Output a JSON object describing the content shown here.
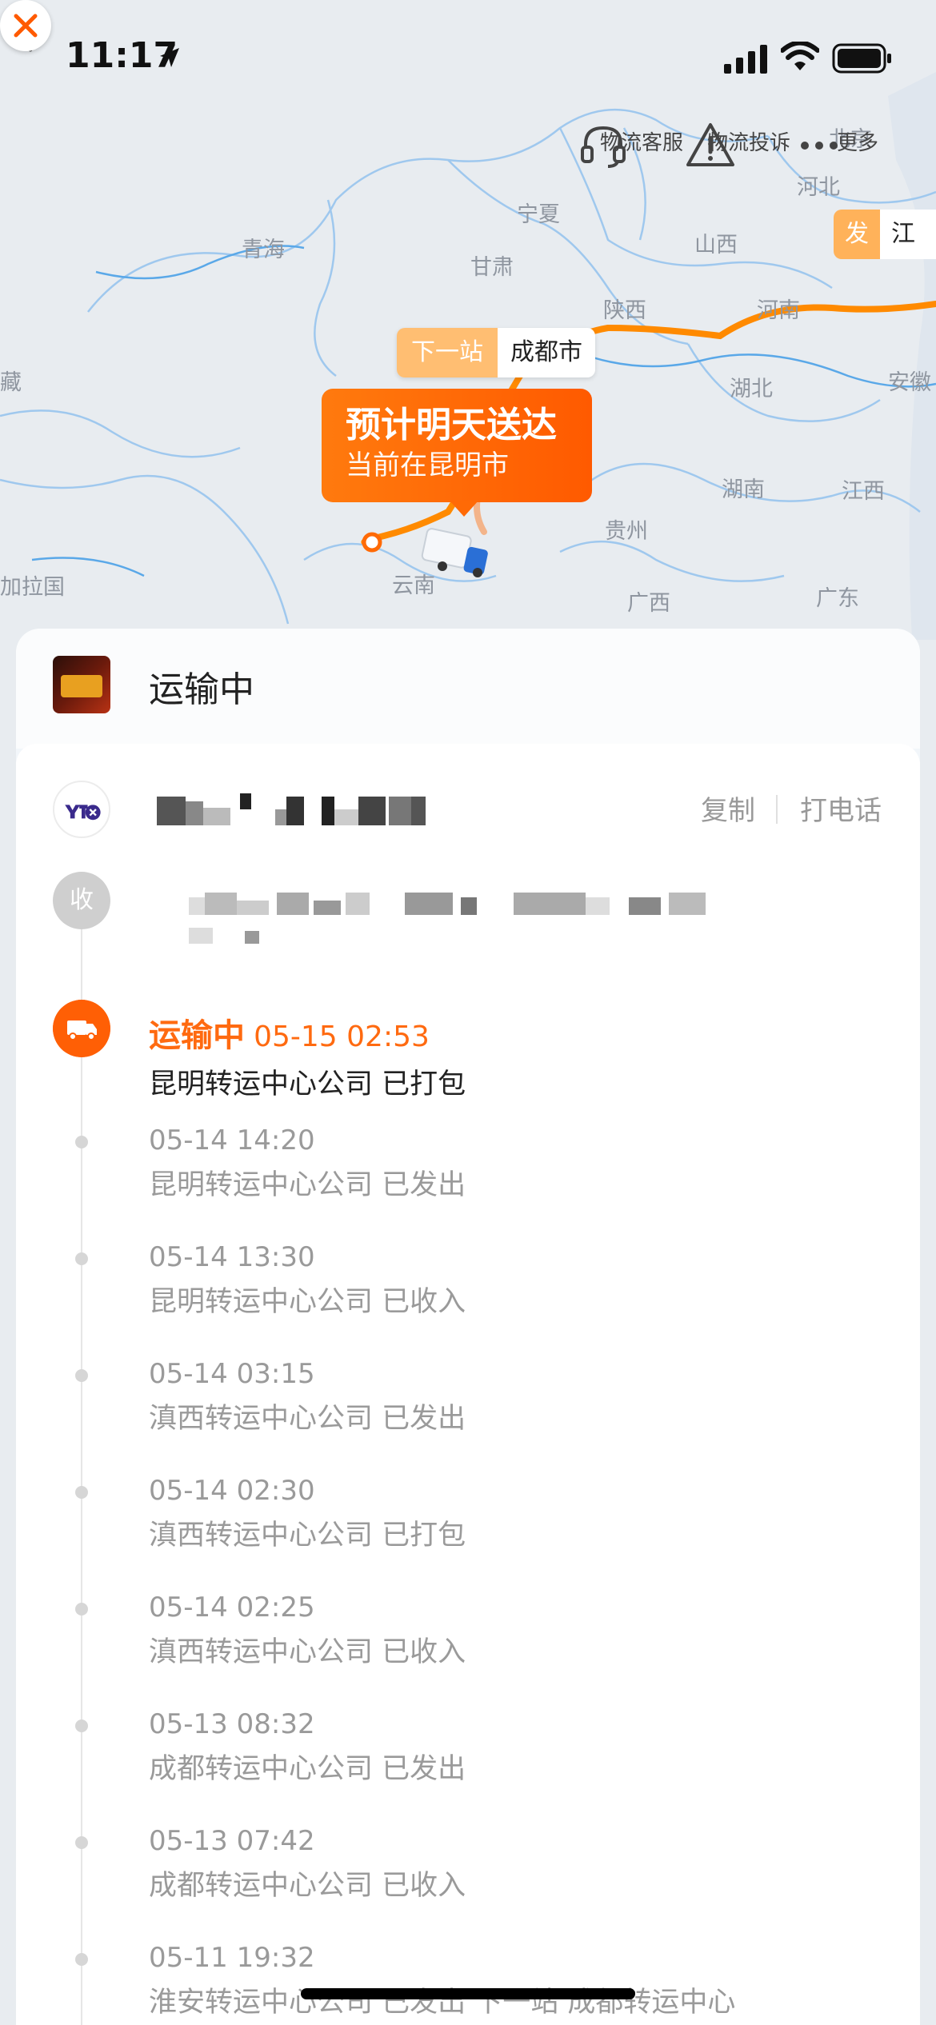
{
  "status_bar": {
    "time": "11:17"
  },
  "map": {
    "provinces": [
      {
        "name": "北京"
      },
      {
        "name": "河北"
      },
      {
        "name": "宁夏"
      },
      {
        "name": "青海"
      },
      {
        "name": "甘肃"
      },
      {
        "name": "山西"
      },
      {
        "name": "陕西"
      },
      {
        "name": "河南"
      },
      {
        "name": "湖北"
      },
      {
        "name": "安徽"
      },
      {
        "name": "湖南"
      },
      {
        "name": "江西"
      },
      {
        "name": "贵州"
      },
      {
        "name": "云南"
      },
      {
        "name": "广西"
      },
      {
        "name": "广东"
      },
      {
        "name": "藏"
      },
      {
        "name": "加拉国"
      }
    ],
    "actions": {
      "service": "物流客服",
      "complaint": "物流投诉",
      "more": "更多"
    },
    "origin_tag": {
      "label": "发",
      "place": "江苏"
    },
    "next_stop": {
      "label": "下一站",
      "city": "成都市"
    },
    "eta": {
      "title": "预计明天送达",
      "subtitle": "当前在昆明市"
    },
    "colors": {
      "route": "#ff8a00",
      "accent": "#ff5f05",
      "river": "#7eb9ea"
    }
  },
  "sheet": {
    "status_title": "运输中",
    "copy_label": "复制",
    "call_label": "打电话",
    "receiver_badge": "收",
    "current": {
      "status": "运输中",
      "time": "05-15 02:53",
      "desc": "昆明转运中心公司 已打包"
    },
    "events": [
      {
        "time": "05-14 14:20",
        "desc": "昆明转运中心公司 已发出"
      },
      {
        "time": "05-14 13:30",
        "desc": "昆明转运中心公司 已收入"
      },
      {
        "time": "05-14 03:15",
        "desc": "滇西转运中心公司 已发出"
      },
      {
        "time": "05-14 02:30",
        "desc": "滇西转运中心公司 已打包"
      },
      {
        "time": "05-14 02:25",
        "desc": "滇西转运中心公司 已收入"
      },
      {
        "time": "05-13 08:32",
        "desc": "成都转运中心公司 已发出"
      },
      {
        "time": "05-13 07:42",
        "desc": "成都转运中心公司 已收入"
      },
      {
        "time": "05-11 19:32",
        "desc": "淮安转运中心公司 已发出 下一站 成都转运中心"
      }
    ]
  }
}
